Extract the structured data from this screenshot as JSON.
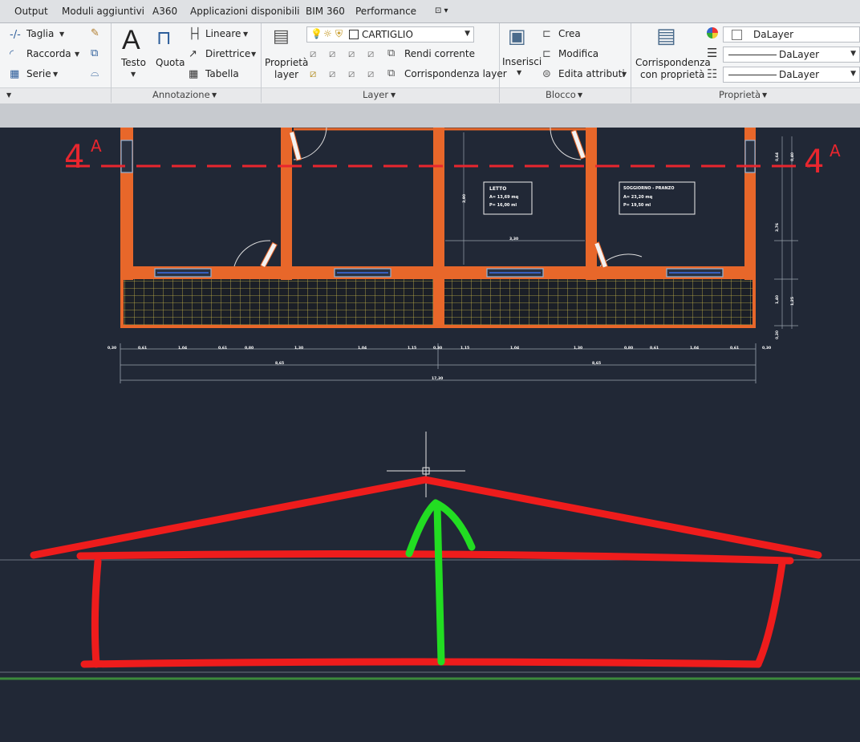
{
  "tabs": [
    "Output",
    "Moduli aggiuntivi",
    "A360",
    "Applicazioni disponibili",
    "BIM 360",
    "Performance"
  ],
  "tab_extra": "⊡ ▾",
  "ribbon": {
    "modifica": {
      "trim": "Taglia",
      "fillet": "Raccorda",
      "array": "Serie"
    },
    "annotazione": {
      "text": "Testo",
      "dimension": "Quota",
      "linear": "Lineare",
      "leader": "Direttrice",
      "table": "Tabella",
      "title": "Annotazione"
    },
    "layer": {
      "current_layer": "CARTIGLIO",
      "properties": "Proprietà layer",
      "properties_l1": "Proprietà",
      "properties_l2": "layer",
      "make_current": "Rendi corrente",
      "match": "Corrispondenza layer",
      "title": "Layer"
    },
    "blocco": {
      "insert": "Inserisci",
      "create": "Crea",
      "edit": "Modifica",
      "edit_attributes": "Edita attributi",
      "title": "Blocco"
    },
    "proprieta": {
      "match_l1": "Corrispondenza",
      "match_l2": "con proprietà",
      "color": "DaLayer",
      "linetype": "DaLayer",
      "lineweight": "DaLayer",
      "title": "Proprietà"
    }
  },
  "drawing": {
    "section_marker_left": "4",
    "section_marker_right": "4",
    "section_letter": "A",
    "room_letto": {
      "name": "LETTO",
      "area": "A= 13,69  mq",
      "perimeter": "P= 16,00  ml"
    },
    "room_soggiorno": {
      "name": "SOGGIORNO - PRANZO",
      "area": "A= 23,20  mq",
      "perimeter": "P= 19,50  ml"
    },
    "dims_row1": [
      "0,30",
      "0,61",
      "1,04",
      "0,61",
      "0,80",
      "1,30",
      "1,04",
      "1,15",
      "0,30",
      "1,15",
      "1,04",
      "1,30",
      "0,80",
      "0,61",
      "1,04",
      "0,61",
      "0,30"
    ],
    "dim_half_left": "8,65",
    "dim_half_right": "8,65",
    "dim_total": "17,30",
    "dim_letto_width": "3,30",
    "dim_letto_height": "3,90",
    "right_dims": [
      "0,64",
      "0,40",
      "3,76",
      "1,40",
      "1,25",
      "0,30"
    ]
  },
  "colors": {
    "wall": "#e8672a",
    "section_line": "#e8262e",
    "annotation_red": "#ee1c1c",
    "annotation_green": "#22dd22",
    "background": "#212836"
  }
}
